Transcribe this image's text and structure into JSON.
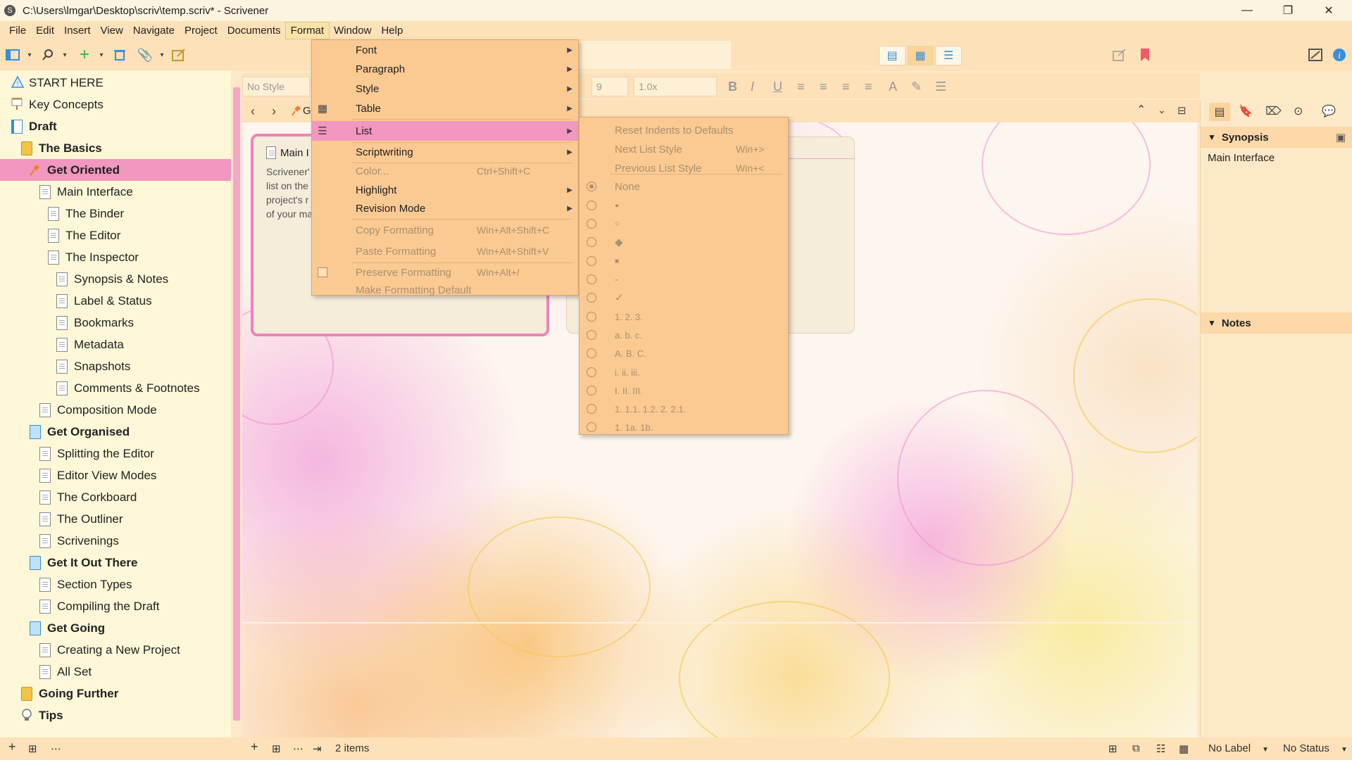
{
  "window": {
    "title": "C:\\Users\\lmgar\\Desktop\\scriv\\temp.scriv* - Scrivener",
    "app_icon": "S",
    "controls": {
      "minimize": "—",
      "restore": "❐",
      "close": "✕"
    }
  },
  "menubar": [
    "File",
    "Edit",
    "Insert",
    "View",
    "Navigate",
    "Project",
    "Documents",
    "Format",
    "Window",
    "Help"
  ],
  "format_menu": {
    "items": [
      {
        "label": "Font",
        "submenu": true
      },
      {
        "label": "Paragraph",
        "submenu": true
      },
      {
        "label": "Style",
        "submenu": true
      },
      {
        "label": "Table",
        "submenu": true,
        "icon": "table-icon"
      },
      {
        "label": "List",
        "submenu": true,
        "icon": "list-icon",
        "highlighted": true
      },
      {
        "label": "Scriptwriting",
        "submenu": true
      },
      {
        "label": "Color...",
        "shortcut": "Ctrl+Shift+C",
        "disabled": true
      },
      {
        "label": "Highlight",
        "submenu": true
      },
      {
        "label": "Revision Mode",
        "submenu": true
      },
      {
        "label": "Copy Formatting",
        "shortcut": "Win+Alt+Shift+C",
        "disabled": true
      },
      {
        "label": "Paste Formatting",
        "shortcut": "Win+Alt+Shift+V",
        "disabled": true
      },
      {
        "label": "Preserve Formatting",
        "shortcut": "Win+Alt+/",
        "disabled": true,
        "checkbox": true
      },
      {
        "label": "Make Formatting Default",
        "disabled": true
      }
    ]
  },
  "list_submenu": {
    "reset": "Reset Indents to Defaults",
    "next": {
      "label": "Next List Style",
      "shortcut": "Win+>"
    },
    "previous": {
      "label": "Previous List Style",
      "shortcut": "Win+<"
    },
    "styles": [
      "None",
      "●",
      "○",
      "◆",
      "■",
      "-",
      "✓",
      "1. 2. 3.",
      "a. b. c.",
      "A. B. C.",
      "i. ii. iii.",
      "I. II. III.",
      "1. 1.1. 1.2. 2. 2.1.",
      "1. 1a. 1b."
    ],
    "selected": "None"
  },
  "binder": {
    "items": [
      {
        "label": "START HERE",
        "icon": "warning-icon",
        "indent": 0
      },
      {
        "label": "Key Concepts",
        "icon": "presentation-icon",
        "indent": 0
      },
      {
        "label": "Draft",
        "icon": "draft-icon",
        "indent": 0,
        "bold": true
      },
      {
        "label": "The Basics",
        "icon": "folder-icon",
        "indent": 1,
        "bold": true
      },
      {
        "label": "Get Oriented",
        "icon": "pin-icon",
        "indent": 2,
        "bold": true,
        "selected": true
      },
      {
        "label": "Main Interface",
        "icon": "document-icon",
        "indent": 3
      },
      {
        "label": "The Binder",
        "icon": "document-icon",
        "indent": 4
      },
      {
        "label": "The Editor",
        "icon": "document-icon",
        "indent": 4
      },
      {
        "label": "The Inspector",
        "icon": "document-icon",
        "indent": 4
      },
      {
        "label": "Synopsis & Notes",
        "icon": "document-icon",
        "indent": 5
      },
      {
        "label": "Label & Status",
        "icon": "document-icon",
        "indent": 5
      },
      {
        "label": "Bookmarks",
        "icon": "document-icon",
        "indent": 5
      },
      {
        "label": "Metadata",
        "icon": "document-icon",
        "indent": 5
      },
      {
        "label": "Snapshots",
        "icon": "document-icon",
        "indent": 5
      },
      {
        "label": "Comments & Footnotes",
        "icon": "document-icon",
        "indent": 5
      },
      {
        "label": "Composition Mode",
        "icon": "document-icon",
        "indent": 3
      },
      {
        "label": "Get Organised",
        "icon": "blue-document-icon",
        "indent": 2,
        "bold": true
      },
      {
        "label": "Splitting the Editor",
        "icon": "document-icon",
        "indent": 3
      },
      {
        "label": "Editor View Modes",
        "icon": "document-icon",
        "indent": 3
      },
      {
        "label": "The Corkboard",
        "icon": "document-icon",
        "indent": 3
      },
      {
        "label": "The Outliner",
        "icon": "document-icon",
        "indent": 3
      },
      {
        "label": "Scrivenings",
        "icon": "document-icon",
        "indent": 3
      },
      {
        "label": "Get It Out There",
        "icon": "blue-document-icon",
        "indent": 2,
        "bold": true
      },
      {
        "label": "Section Types",
        "icon": "document-icon",
        "indent": 3
      },
      {
        "label": "Compiling the Draft",
        "icon": "document-icon",
        "indent": 3
      },
      {
        "label": "Get Going",
        "icon": "blue-document-icon",
        "indent": 2,
        "bold": true
      },
      {
        "label": "Creating a New Project",
        "icon": "document-icon",
        "indent": 3
      },
      {
        "label": "All Set",
        "icon": "document-icon",
        "indent": 3
      },
      {
        "label": "Going Further",
        "icon": "folder-icon",
        "indent": 1,
        "bold": true
      },
      {
        "label": "Tips",
        "icon": "lightbulb-icon",
        "indent": 1,
        "bold": true
      }
    ]
  },
  "formatbar": {
    "style": "No Style",
    "size": "9",
    "spacing": "1.0x"
  },
  "header": {
    "title_fragment": "G"
  },
  "corkboard": {
    "cards": [
      {
        "title": "Main I",
        "body": "Scrivener'\nlist on the\nproject's r\nof your ma"
      },
      {
        "title": "",
        "body": ""
      }
    ]
  },
  "inspector": {
    "synopsis_header": "Synopsis",
    "synopsis_text": "Main Interface",
    "notes_header": "Notes"
  },
  "statusbar": {
    "items_count": "2 items",
    "label": "No Label",
    "status": "No Status"
  },
  "colors": {
    "accent_pink": "#f297bd",
    "menu_bg": "#fbc992",
    "toolbar_bg": "#fde1b8",
    "binder_bg": "#fef7d8",
    "icon_blue": "#3a8ed8"
  }
}
